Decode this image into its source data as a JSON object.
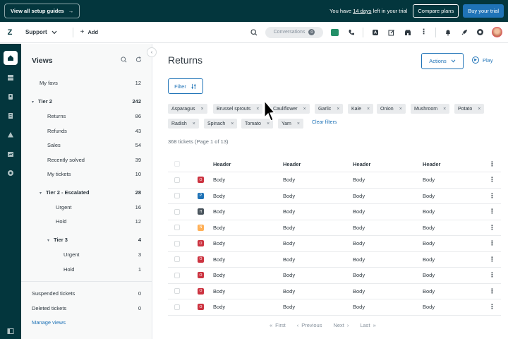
{
  "banner": {
    "guides_label": "View all setup guides",
    "trial_prefix": "You have",
    "trial_days": "14 days",
    "trial_suffix": "left in your trial",
    "compare_label": "Compare plans",
    "buy_label": "Buy your trial"
  },
  "header": {
    "product": "Support",
    "add_label": "Add",
    "conversations_label": "Conversations",
    "conversations_count": "0"
  },
  "views": {
    "title": "Views",
    "items": [
      {
        "label": "My favs",
        "count": "12"
      },
      {
        "label": "Tier 2",
        "count": "242"
      },
      {
        "label": "Returns",
        "count": "86"
      },
      {
        "label": "Refunds",
        "count": "43"
      },
      {
        "label": "Sales",
        "count": "54"
      },
      {
        "label": "Recently solved",
        "count": "39"
      },
      {
        "label": "My tickets",
        "count": "10"
      },
      {
        "label": "Tier 2 - Escalated",
        "count": "28"
      },
      {
        "label": "Urgent",
        "count": "16"
      },
      {
        "label": "Hold",
        "count": "12"
      },
      {
        "label": "Tier 3",
        "count": "4"
      },
      {
        "label": "Urgent",
        "count": "3"
      },
      {
        "label": "Hold",
        "count": "1"
      }
    ],
    "suspended": {
      "label": "Suspended tickets",
      "count": "0"
    },
    "deleted": {
      "label": "Deleted tickets",
      "count": "0"
    },
    "manage_label": "Manage views"
  },
  "main": {
    "title": "Returns",
    "actions_label": "Actions",
    "play_label": "Play",
    "filter_label": "Filter",
    "tags": [
      "Asparagus",
      "Brussel sprouts",
      "Cauliflower",
      "Garlic",
      "Kale",
      "Onion",
      "Mushroom",
      "Potato",
      "Radish",
      "Spinach",
      "Tomato",
      "Yam"
    ],
    "clear_label": "Clear filters",
    "count_text": "368 tickets",
    "page_text": "(Page 1 of 13)",
    "headers": [
      "Header",
      "Header",
      "Header",
      "Header"
    ],
    "rows": [
      {
        "status": "O",
        "color": "#cc3340",
        "cells": [
          "Body",
          "Body",
          "Body",
          "Body"
        ]
      },
      {
        "status": "P",
        "color": "#1f73b7",
        "cells": [
          "Body",
          "Body",
          "Body",
          "Body"
        ]
      },
      {
        "status": "H",
        "color": "#49545c",
        "cells": [
          "Body",
          "Body",
          "Body",
          "Body"
        ]
      },
      {
        "status": "N",
        "color": "#ffb057",
        "cells": [
          "Body",
          "Body",
          "Body",
          "Body"
        ]
      },
      {
        "status": "O",
        "color": "#cc3340",
        "cells": [
          "Body",
          "Body",
          "Body",
          "Body"
        ]
      },
      {
        "status": "O",
        "color": "#cc3340",
        "cells": [
          "Body",
          "Body",
          "Body",
          "Body"
        ]
      },
      {
        "status": "O",
        "color": "#cc3340",
        "cells": [
          "Body",
          "Body",
          "Body",
          "Body"
        ]
      },
      {
        "status": "O",
        "color": "#cc3340",
        "cells": [
          "Body",
          "Body",
          "Body",
          "Body"
        ]
      },
      {
        "status": "O",
        "color": "#cc3340",
        "cells": [
          "Body",
          "Body",
          "Body",
          "Body"
        ]
      }
    ],
    "pager": {
      "first": "First",
      "previous": "Previous",
      "next": "Next",
      "last": "Last"
    }
  },
  "colors": {
    "brand_dark": "#03363d",
    "accent": "#1f73b7"
  }
}
